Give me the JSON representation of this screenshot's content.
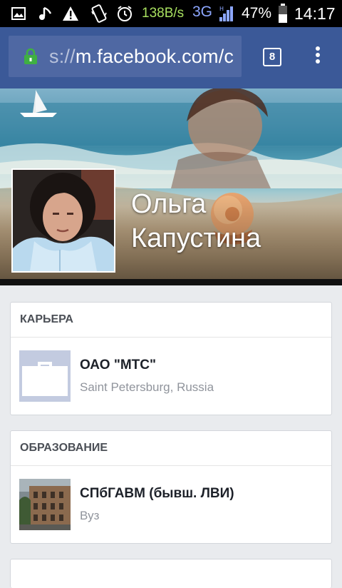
{
  "status_bar": {
    "net_speed": "138B/s",
    "network_type": "3G",
    "battery_percent": "47%",
    "time": "14:17",
    "icons": [
      "image-icon",
      "music-icon",
      "warning-icon",
      "phone-vibrate-icon",
      "alarm-icon",
      "signal-icon",
      "battery-icon"
    ]
  },
  "browser": {
    "url_scheme": "s://",
    "url_host": "m.facebook.com/c",
    "tab_count": "8",
    "icons": [
      "lock-icon",
      "tabs-icon",
      "overflow-menu-icon"
    ]
  },
  "profile": {
    "name": "Ольга Капустина"
  },
  "career": {
    "header": "КАРЬЕРА",
    "employer": "ОАО \"МТС\"",
    "location": "Saint Petersburg, Russia",
    "icon": "briefcase-icon"
  },
  "education": {
    "header": "ОБРАЗОВАНИЕ",
    "school": "СПбГАВМ (бывш. ЛВИ)",
    "type": "Вуз"
  },
  "colors": {
    "facebook_blue": "#3b5998",
    "page_bg": "#e9ebee",
    "status_speed": "#a8e05f",
    "status_network": "#8da7ff",
    "lock_green": "#3fb042"
  }
}
